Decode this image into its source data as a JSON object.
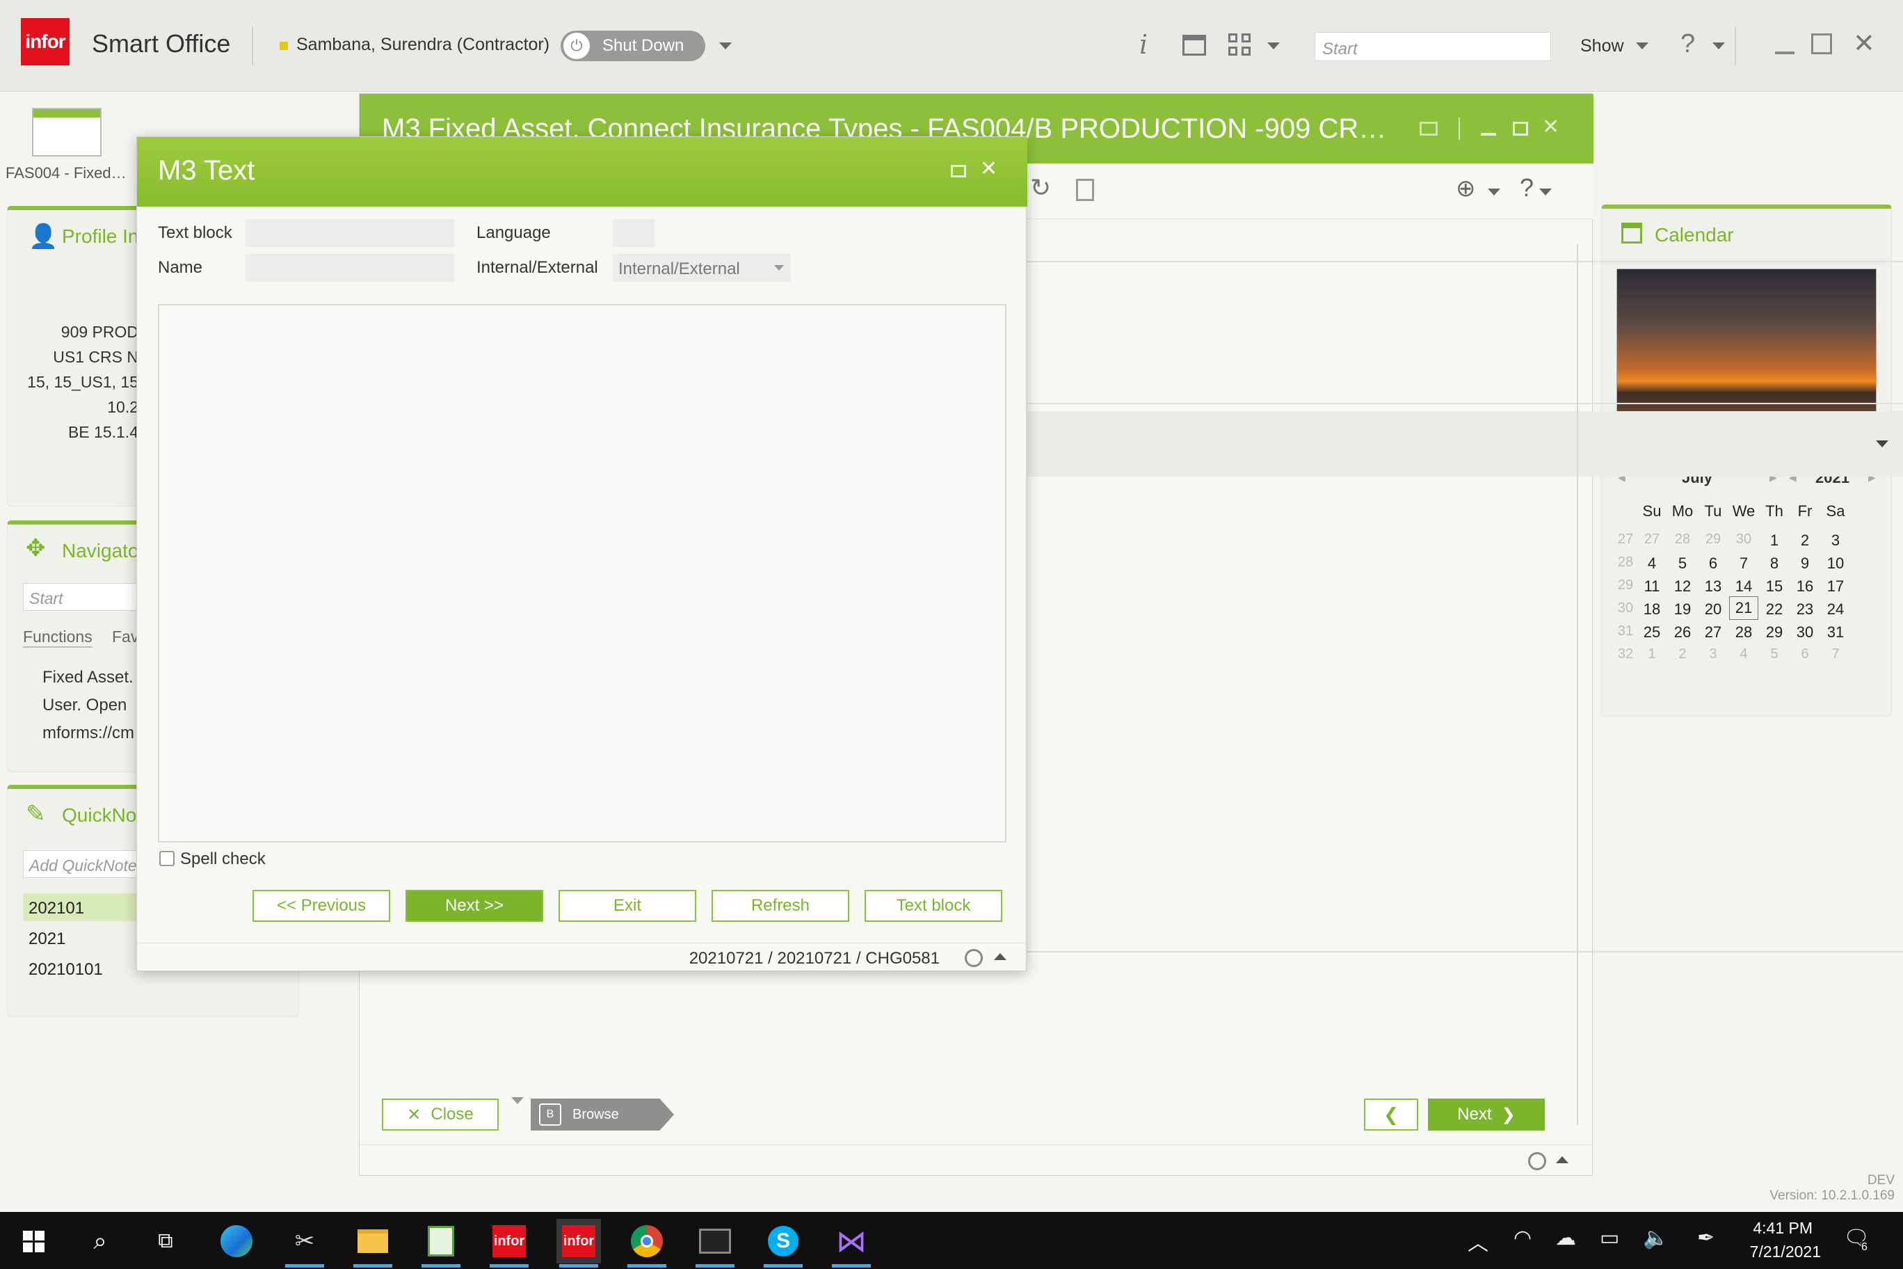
{
  "topbar": {
    "logo_text": "infor",
    "app_title": "Smart Office",
    "user_name": "Sambana, Surendra (Contractor)",
    "shutdown_label": "Shut Down",
    "search_placeholder": "Start",
    "show_label": "Show"
  },
  "tasks": [
    {
      "label": "FAS004 - Fixed…"
    }
  ],
  "profile": {
    "title": "Profile In",
    "lines": [
      "909 PROD",
      "US1 CRS N",
      "15, 15_US1, 15",
      "10.2",
      "BE 15.1.4"
    ]
  },
  "navigator": {
    "title": "Navigato",
    "search_placeholder": "Start",
    "tabs": [
      "Functions",
      "Fav"
    ],
    "items": [
      "Fixed Asset.",
      "User. Open",
      "mforms://cm"
    ]
  },
  "quicknote": {
    "title": "QuickNo",
    "placeholder": "Add QuickNote",
    "items": [
      "202101",
      "2021",
      "20210101"
    ]
  },
  "calendar": {
    "title": "Calendar",
    "month": "July",
    "year": "2021",
    "weekdays": [
      "Su",
      "Mo",
      "Tu",
      "We",
      "Th",
      "Fr",
      "Sa"
    ],
    "weeks": [
      {
        "num": "27",
        "days": [
          "27",
          "28",
          "29",
          "30",
          "1",
          "2",
          "3"
        ]
      },
      {
        "num": "28",
        "days": [
          "4",
          "5",
          "6",
          "7",
          "8",
          "9",
          "10"
        ]
      },
      {
        "num": "29",
        "days": [
          "11",
          "12",
          "13",
          "14",
          "15",
          "16",
          "17"
        ]
      },
      {
        "num": "30",
        "days": [
          "18",
          "19",
          "20",
          "21",
          "22",
          "23",
          "24"
        ]
      },
      {
        "num": "31",
        "days": [
          "25",
          "26",
          "27",
          "28",
          "29",
          "30",
          "31"
        ]
      },
      {
        "num": "32",
        "days": [
          "1",
          "2",
          "3",
          "4",
          "5",
          "6",
          "7"
        ]
      }
    ],
    "today": "21"
  },
  "main_window": {
    "title": "M3 Fixed Asset. Connect Insurance Types - FAS004/B   PRODUCTION -909 CR…",
    "close_label": "Close",
    "browse_key": "B",
    "browse_label": "Browse",
    "next_label": "Next"
  },
  "dialog": {
    "title": "M3 Text",
    "text_block_label": "Text block",
    "text_block_value": "",
    "name_label": "Name",
    "name_value": "",
    "language_label": "Language",
    "language_value": "",
    "ie_label": "Internal/External",
    "ie_value": "Internal/External",
    "text_content": "",
    "spell_check_label": "Spell check",
    "buttons": {
      "previous": "<< Previous",
      "next": "Next >>",
      "exit": "Exit",
      "refresh": "Refresh",
      "text_block": "Text block"
    },
    "status": "20210721 / 20210721 / CHG0581"
  },
  "footer": {
    "env": "DEV",
    "version": "Version: 10.2.1.0.169"
  },
  "taskbar": {
    "time": "4:41 PM",
    "date": "7/21/2021",
    "notification_count": "6",
    "infor_label": "infor"
  },
  "colors": {
    "accent": "#8cbf3a",
    "accent_dark": "#7ab52c",
    "brand_red": "#e3101e"
  }
}
